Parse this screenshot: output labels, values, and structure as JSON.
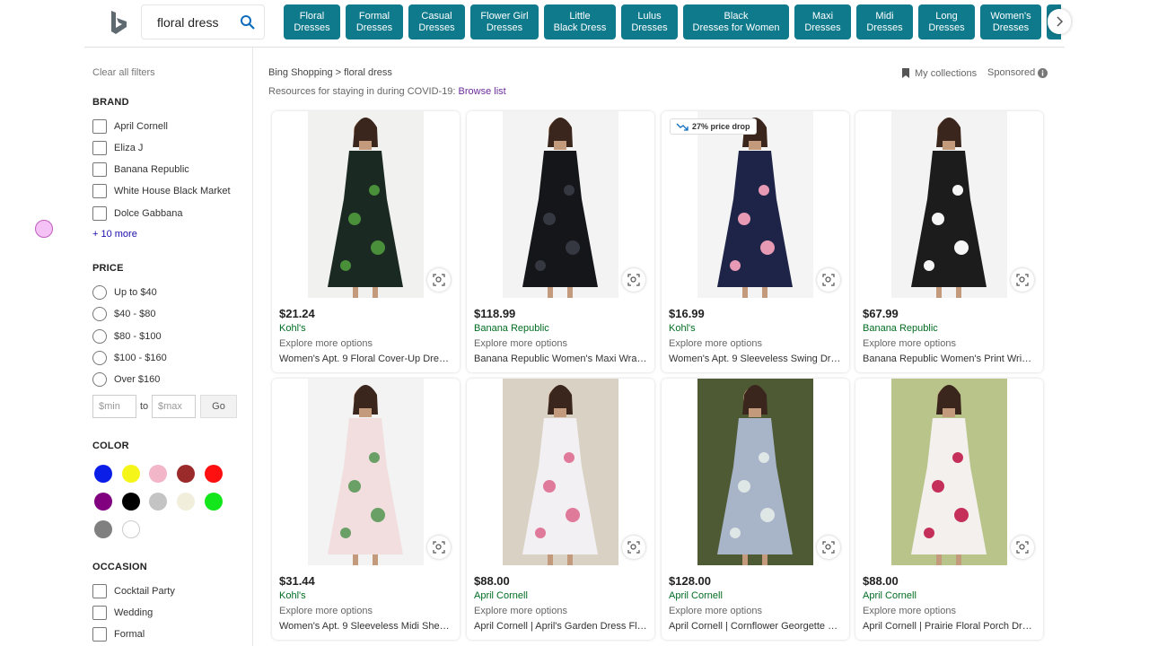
{
  "search": {
    "query": "floral dress"
  },
  "pills": [
    {
      "line1": "Floral",
      "line2": "Dresses"
    },
    {
      "line1": "Formal",
      "line2": "Dresses"
    },
    {
      "line1": "Casual",
      "line2": "Dresses"
    },
    {
      "line1": "Flower Girl",
      "line2": "Dresses"
    },
    {
      "line1": "Little",
      "line2": "Black Dress"
    },
    {
      "line1": "Lulus",
      "line2": "Dresses"
    },
    {
      "line1": "Black",
      "line2": "Dresses for Women"
    },
    {
      "line1": "Maxi",
      "line2": "Dresses"
    },
    {
      "line1": "Midi",
      "line2": "Dresses"
    },
    {
      "line1": "Long",
      "line2": "Dresses"
    },
    {
      "line1": "Women's",
      "line2": "Dresses"
    }
  ],
  "sidebar": {
    "clear": "Clear all filters",
    "brand_title": "BRAND",
    "brands": [
      "April Cornell",
      "Eliza J",
      "Banana Republic",
      "White House Black Market",
      "Dolce Gabbana"
    ],
    "more": "+ 10 more",
    "price_title": "PRICE",
    "prices": [
      "Up to $40",
      "$40 - $80",
      "$80 - $100",
      "$100 - $160",
      "Over $160"
    ],
    "min_placeholder": "$min",
    "max_placeholder": "$max",
    "to": "to",
    "go": "Go",
    "color_title": "COLOR",
    "colors": [
      "#0b1ee8",
      "#f5f51a",
      "#f2b6c8",
      "#9b2a2a",
      "#ff1010",
      "#800080",
      "#000000",
      "#c4c4c4",
      "#f1efdc",
      "#13e61a",
      "#808080",
      "#ffffff"
    ],
    "occasion_title": "OCCASION",
    "occasions": [
      "Cocktail Party",
      "Wedding",
      "Formal"
    ]
  },
  "main": {
    "breadcrumb": "Bing Shopping > floral dress",
    "covid_text": "Resources for staying in during COVID-19:",
    "covid_link": "Browse list",
    "collections": "My collections",
    "sponsored": "Sponsored"
  },
  "products": [
    {
      "price": "$21.24",
      "seller": "Kohl's",
      "explore": "Explore more options",
      "title": "Women's Apt. 9 Floral Cover-Up Dress, ...",
      "badge": "",
      "bg": "#f1f1ef",
      "dress": "#1a2a22",
      "accent": "#4a8f3a"
    },
    {
      "price": "$118.99",
      "seller": "Banana Republic",
      "explore": "Explore more options",
      "title": "Banana Republic Women's Maxi Wrap ...",
      "badge": "",
      "bg": "#f3f3f3",
      "dress": "#15161a",
      "accent": "#353840"
    },
    {
      "price": "$16.99",
      "seller": "Kohl's",
      "explore": "Explore more options",
      "title": "Women's Apt. 9 Sleeveless Swing Dres...",
      "badge": "27% price drop",
      "bg": "#f4f4f4",
      "dress": "#1d2447",
      "accent": "#e79ab4"
    },
    {
      "price": "$67.99",
      "seller": "Banana Republic",
      "explore": "Explore more options",
      "title": "Banana Republic Women's Print Wrinkl...",
      "badge": "",
      "bg": "#f3f3f3",
      "dress": "#1c1c1c",
      "accent": "#f5f5f5"
    },
    {
      "price": "$31.44",
      "seller": "Kohl's",
      "explore": "Explore more options",
      "title": "Women's Apt. 9 Sleeveless Midi Sheat...",
      "badge": "",
      "bg": "#f3f3f3",
      "dress": "#f2dede",
      "accent": "#6aa066"
    },
    {
      "price": "$88.00",
      "seller": "April Cornell",
      "explore": "Explore more options",
      "title": "April Cornell | April's Garden Dress Flor...",
      "badge": "",
      "bg": "#d9d2c4",
      "dress": "#f2f0f3",
      "accent": "#e07a9a"
    },
    {
      "price": "$128.00",
      "seller": "April Cornell",
      "explore": "Explore more options",
      "title": "April Cornell | Cornflower Georgette Dr...",
      "badge": "",
      "bg": "#4d5a34",
      "dress": "#a8b4c8",
      "accent": "#dfe6e6"
    },
    {
      "price": "$88.00",
      "seller": "April Cornell",
      "explore": "Explore more options",
      "title": "April Cornell | Prairie Floral Porch Dres...",
      "badge": "",
      "bg": "#b9c48a",
      "dress": "#f4f0ee",
      "accent": "#c4305a"
    }
  ]
}
